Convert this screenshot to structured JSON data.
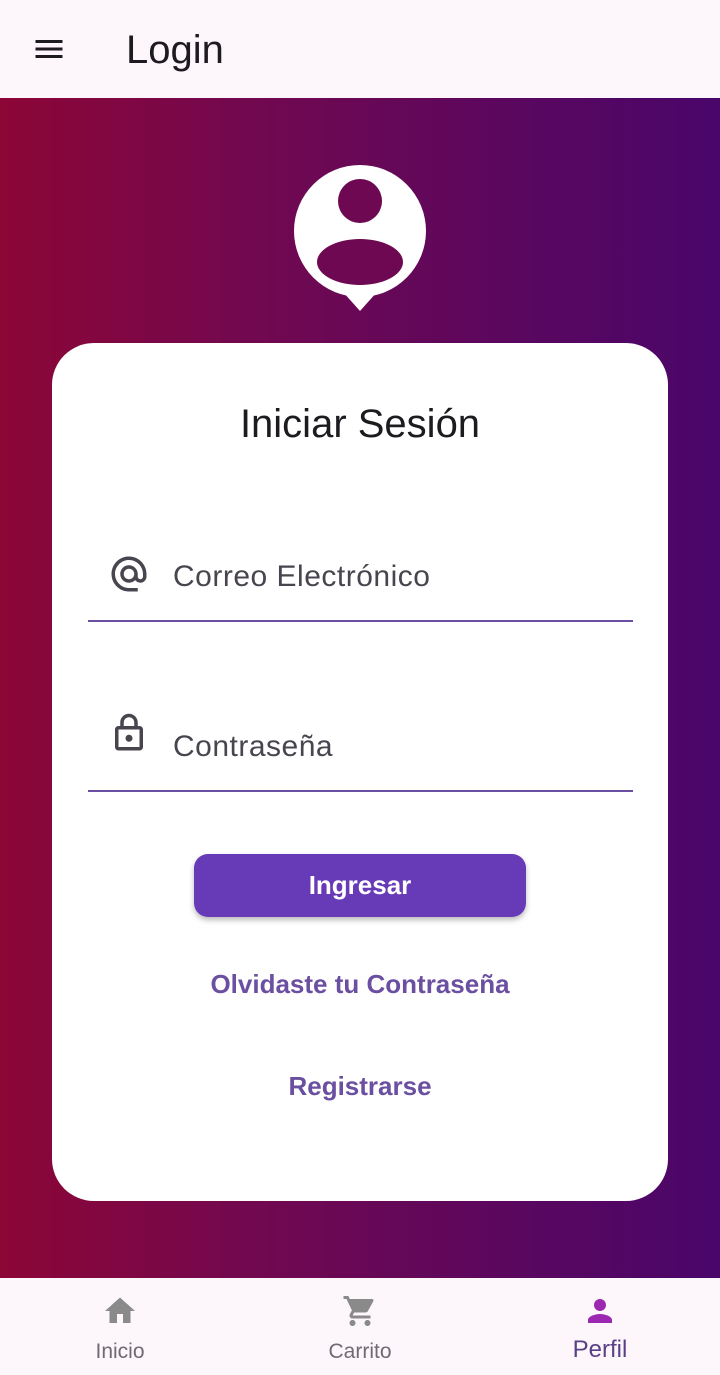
{
  "appbar": {
    "title": "Login",
    "menu_icon": "menu-icon"
  },
  "header": {
    "avatar_icon": "account-pin-icon"
  },
  "login": {
    "title": "Iniciar Sesión",
    "email": {
      "placeholder": "Correo Electrónico",
      "value": "",
      "icon": "at-sign-icon"
    },
    "password": {
      "placeholder": "Contraseña",
      "value": "",
      "icon": "lock-icon"
    },
    "submit_label": "Ingresar",
    "forgot_label": "Olvidaste tu Contraseña",
    "register_label": "Registrarse"
  },
  "bottom_nav": {
    "items": [
      {
        "label": "Inicio",
        "icon": "home-icon",
        "active": false
      },
      {
        "label": "Carrito",
        "icon": "cart-icon",
        "active": false
      },
      {
        "label": "Perfil",
        "icon": "person-icon",
        "active": true
      }
    ]
  },
  "colors": {
    "gradient_start": "#8c0636",
    "gradient_end": "#4a066a",
    "primary": "#673ab7",
    "link": "#6b4fa0",
    "active_nav_icon": "#9c27b0",
    "inactive_nav_icon": "#8a8a8a"
  }
}
